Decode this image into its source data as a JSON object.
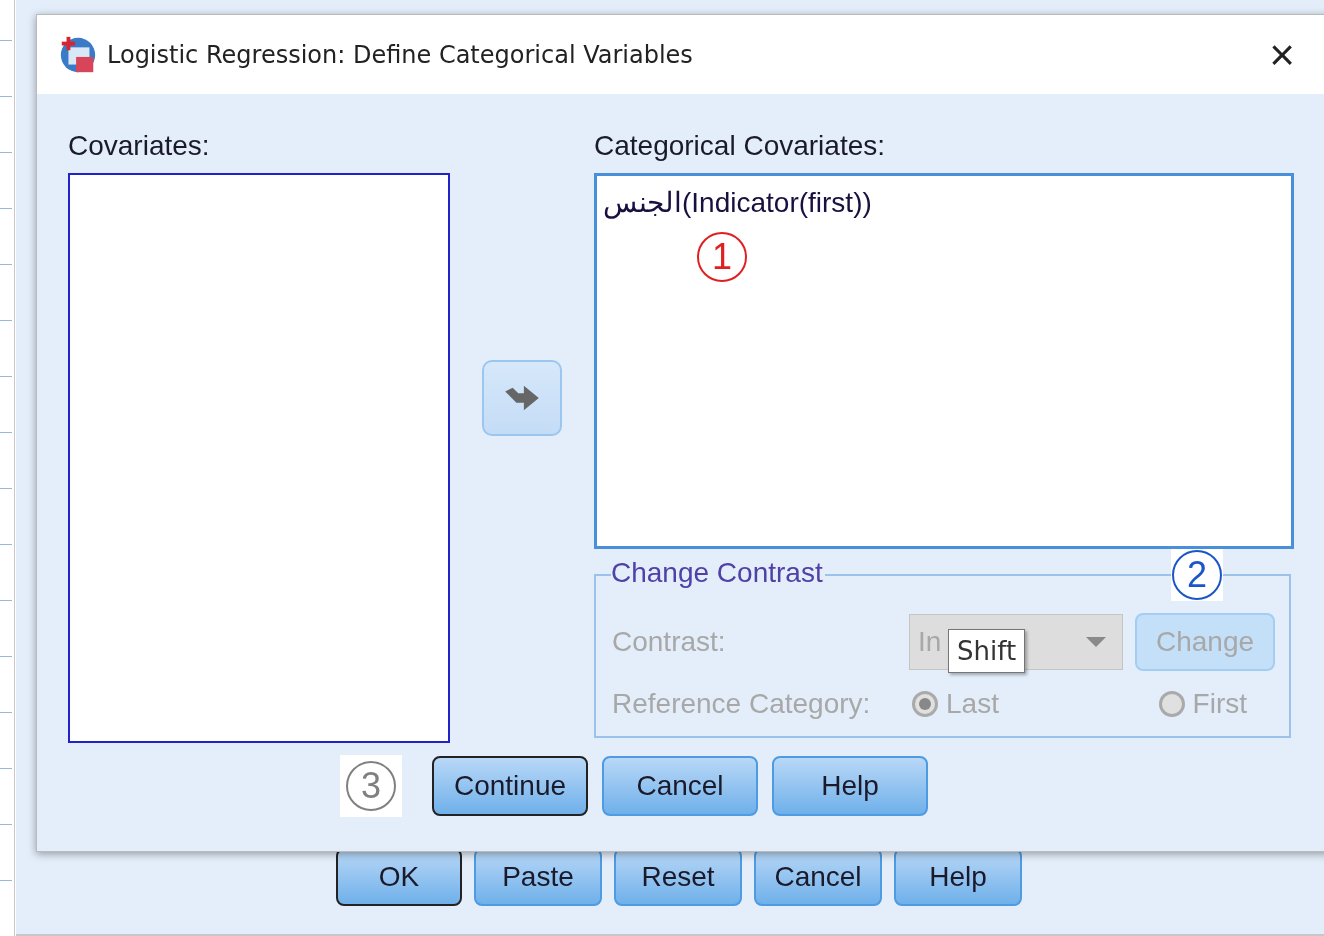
{
  "background_window": {
    "buttons": [
      {
        "label": "OK",
        "default": true
      },
      {
        "label": "Paste",
        "default": false
      },
      {
        "label": "Reset",
        "default": false
      },
      {
        "label": "Cancel",
        "default": false
      },
      {
        "label": "Help",
        "default": false
      }
    ]
  },
  "dialog": {
    "title": "Logistic Regression: Define Categorical Variables",
    "close": "×",
    "covariates": {
      "label": "Covariates:"
    },
    "categorical_covariates": {
      "label": "Categorical Covariates:",
      "items": [
        {
          "text": "الجنس(Indicator(first))"
        }
      ]
    },
    "change_contrast": {
      "title": "Change Contrast",
      "disabled": true,
      "contrast_label": "Contrast:",
      "contrast_value": "In",
      "change_button": "Change",
      "reference_label": "Reference Category:",
      "reference_options": [
        {
          "label": "Last",
          "selected": true
        },
        {
          "label": "First",
          "selected": false
        }
      ],
      "tooltip": "Shift"
    },
    "buttons": [
      {
        "label": "Continue",
        "default": true
      },
      {
        "label": "Cancel",
        "default": false
      },
      {
        "label": "Help",
        "default": false
      }
    ]
  },
  "annotations": [
    {
      "text": "1",
      "color": "#e02020"
    },
    {
      "text": "2",
      "color": "#1a56c8"
    },
    {
      "text": "3",
      "color": "#808080"
    }
  ]
}
